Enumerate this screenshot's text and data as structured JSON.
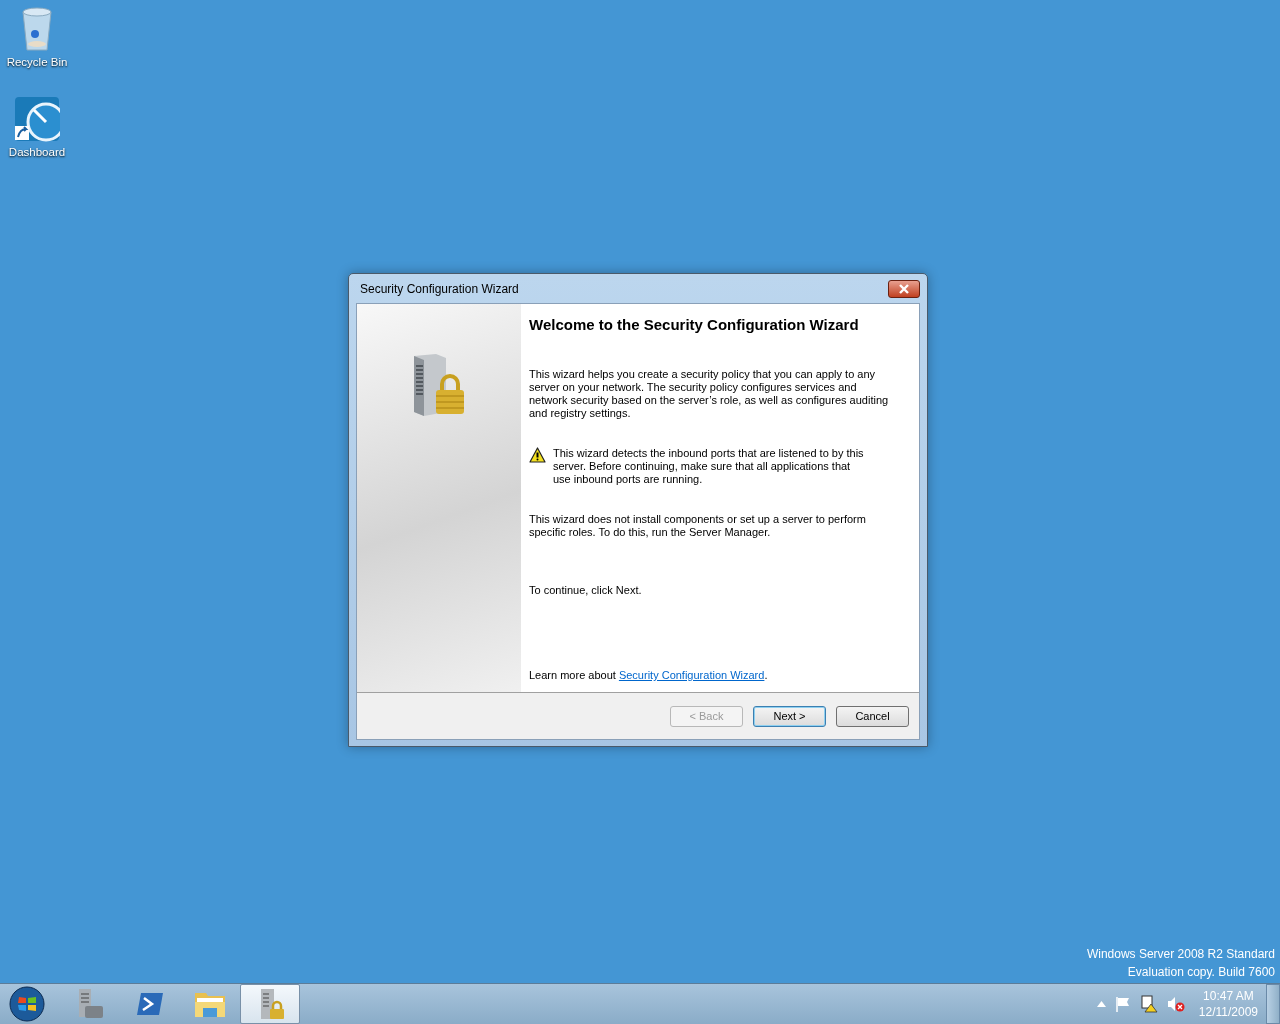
{
  "desktop_icons": [
    {
      "label": "Recycle Bin",
      "kind": "recycle"
    },
    {
      "label": "Dashboard",
      "kind": "dashboard"
    }
  ],
  "dialog": {
    "title": "Security Configuration Wizard",
    "heading": "Welcome to the Security Configuration Wizard",
    "blocks": [
      {
        "kind": "text",
        "text": "This wizard helps you create a security policy that you can apply to any server on your network. The security policy configures services and network security based on the server’s role, as well as configures auditing and registry settings."
      },
      {
        "kind": "warning",
        "text": "This wizard detects the inbound ports that are listened to by this server. Before continuing, make sure that all applications that use inbound ports are running."
      },
      {
        "kind": "text",
        "text": "This wizard does not install components or set up a server to perform specific roles. To do this, run the Server Manager."
      },
      {
        "kind": "text",
        "text": "To continue, click Next."
      }
    ],
    "learn_more": {
      "before": "Learn more about ",
      "link": "Security Configuration Wizard",
      "after": "."
    },
    "buttons": [
      {
        "label": "< Back",
        "disabled": true,
        "default": false
      },
      {
        "label": "Next >",
        "disabled": false,
        "default": true
      },
      {
        "label": "Cancel",
        "disabled": false,
        "default": false
      }
    ]
  },
  "os_notice": [
    "Windows Server 2008 R2 Standard",
    "Evaluation copy. Build 7600"
  ],
  "taskbar": {
    "items": [
      {
        "kind": "server-tools",
        "selected": false
      },
      {
        "kind": "shell",
        "selected": false
      },
      {
        "kind": "folder",
        "selected": false
      },
      {
        "kind": "server-lock",
        "selected": true
      }
    ],
    "tray": [
      {
        "kind": "arrow"
      },
      {
        "kind": "flag"
      },
      {
        "kind": "network"
      },
      {
        "kind": "speaker"
      }
    ],
    "clock": {
      "time": "10:47 AM",
      "date": "12/11/2009"
    }
  }
}
